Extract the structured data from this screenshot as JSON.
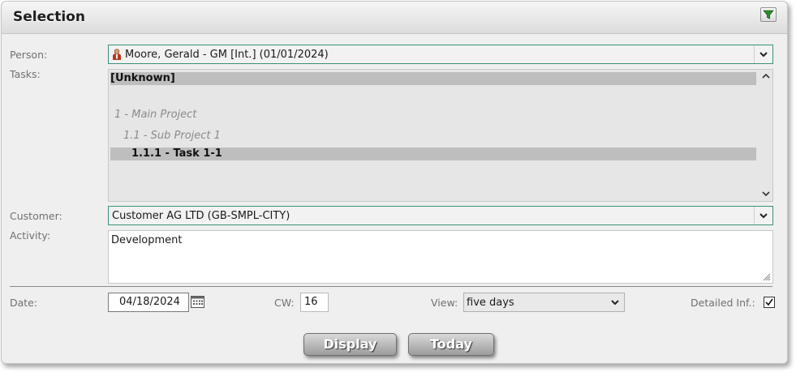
{
  "panel": {
    "title": "Selection"
  },
  "filter": {
    "icon": "funnel-icon"
  },
  "person": {
    "label": "Person:",
    "value": "Moore, Gerald - GM [Int.] (01/01/2024)",
    "icon": "person-icon"
  },
  "tasks": {
    "label": "Tasks:",
    "items": [
      {
        "text": "[Unknown]",
        "state": "selected"
      },
      {
        "text": "1 - Main Project",
        "state": "dim"
      },
      {
        "text": "1.1 - Sub Project 1",
        "state": "dim"
      },
      {
        "text": "1.1.1 - Task 1-1",
        "state": "selected"
      }
    ]
  },
  "customer": {
    "label": "Customer:",
    "value": "Customer AG LTD (GB-SMPL-CITY)"
  },
  "activity": {
    "label": "Activity:",
    "value": "Development"
  },
  "date": {
    "label": "Date:",
    "value": "04/18/2024",
    "icon": "calendar-icon"
  },
  "cw": {
    "label": "CW:",
    "value": "16"
  },
  "view": {
    "label": "View:",
    "value": "five days"
  },
  "detailed": {
    "label": "Detailed Inf.:",
    "checked": true
  },
  "buttons": {
    "display": "Display",
    "today": "Today"
  },
  "colors": {
    "accent_border": "#3c8f7c",
    "panel_bg": "#efefef",
    "selected_row": "#bebebe"
  }
}
